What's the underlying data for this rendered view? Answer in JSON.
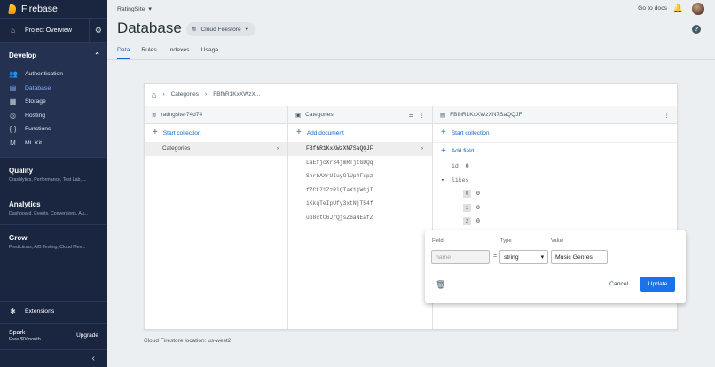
{
  "sidebar": {
    "brand": "Firebase",
    "project_overview": "Project Overview",
    "develop": {
      "title": "Develop",
      "items": [
        {
          "label": "Authentication",
          "icon": "people-icon"
        },
        {
          "label": "Database",
          "icon": "database-icon",
          "active": true
        },
        {
          "label": "Storage",
          "icon": "storage-icon"
        },
        {
          "label": "Hosting",
          "icon": "globe-icon"
        },
        {
          "label": "Functions",
          "icon": "functions-icon"
        },
        {
          "label": "ML Kit",
          "icon": "ml-kit-icon"
        }
      ]
    },
    "sections": [
      {
        "title": "Quality",
        "subtitle": "Crashlytics, Performance, Test Lab, ..."
      },
      {
        "title": "Analytics",
        "subtitle": "Dashboard, Events, Conversions, Au..."
      },
      {
        "title": "Grow",
        "subtitle": "Predictions, A/B Testing, Cloud Mes..."
      }
    ],
    "extensions": "Extensions",
    "plan": {
      "name": "Spark",
      "price": "Free $0/month",
      "upgrade": "Upgrade"
    }
  },
  "header": {
    "project": "RatingSite",
    "go_to_docs": "Go to docs",
    "title": "Database",
    "chip": "Cloud Firestore",
    "tabs": [
      "Data",
      "Rules",
      "Indexes",
      "Usage"
    ],
    "active_tab": "Data"
  },
  "breadcrumb": [
    "Categories",
    "FBfhR1KxXWzX..."
  ],
  "columns": {
    "root": {
      "title": "ratingsite-74d74",
      "add": "Start collection",
      "items": [
        "Categories"
      ]
    },
    "collection": {
      "title": "Categories",
      "add": "Add document",
      "items": [
        "FBfhR1KxXWzXN7SaQQJF",
        "LaEfjcXr34jmRTjtGDQq",
        "SnrbAXrUIuyOlUp4Fxpz",
        "fZCt71ZzRlQTaK1jWCjI",
        "iKkqTeIpUfy3xtNjT54f",
        "ub8ctC6JrQjsZ6aNEafZ"
      ]
    },
    "document": {
      "title": "FBfhR1KxXWzXN7SaQQJF",
      "add_collection": "Start collection",
      "add_field": "Add field",
      "fields": [
        {
          "key": "id:",
          "value": "0"
        }
      ],
      "array": {
        "key": "likes",
        "items": [
          {
            "index": "0",
            "value": "0"
          },
          {
            "index": "1",
            "value": "0"
          },
          {
            "index": "2",
            "value": "0"
          }
        ]
      }
    }
  },
  "edit_popup": {
    "field_label": "Field",
    "type_label": "Type",
    "value_label": "Value",
    "name_placeholder": "name",
    "equals": "=",
    "type_value": "string",
    "value_value": "Music Genres",
    "cancel": "Cancel",
    "update": "Update"
  },
  "footer": {
    "location": "Cloud Firestore location: us-west2"
  }
}
